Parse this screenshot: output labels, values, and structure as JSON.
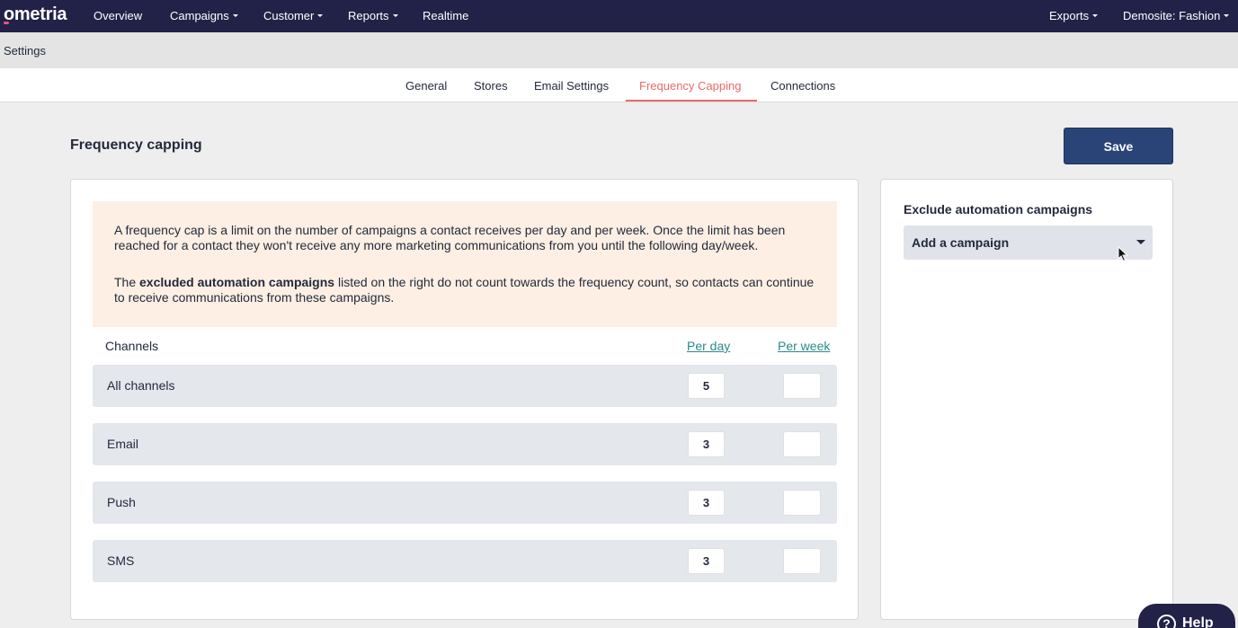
{
  "app": {
    "brand": "ometria",
    "accent_color": "#e86a6a",
    "nav_color": "#222248"
  },
  "topnav": {
    "items": [
      {
        "label": "Overview",
        "has_dropdown": false
      },
      {
        "label": "Campaigns",
        "has_dropdown": true
      },
      {
        "label": "Customer",
        "has_dropdown": true
      },
      {
        "label": "Reports",
        "has_dropdown": true
      },
      {
        "label": "Realtime",
        "has_dropdown": false
      }
    ],
    "right_items": [
      {
        "label": "Exports",
        "has_dropdown": true
      },
      {
        "label": "Demosite: Fashion",
        "has_dropdown": true
      }
    ]
  },
  "breadcrumb": {
    "label": "Settings"
  },
  "tabs": [
    {
      "label": "General",
      "active": false
    },
    {
      "label": "Stores",
      "active": false
    },
    {
      "label": "Email Settings",
      "active": false
    },
    {
      "label": "Frequency Capping",
      "active": true
    },
    {
      "label": "Connections",
      "active": false
    }
  ],
  "header": {
    "title": "Frequency capping",
    "save_label": "Save"
  },
  "info": {
    "paragraph1": "A frequency cap is a limit on the number of campaigns a contact receives per day and per week. Once the limit has been reached for a contact they won't receive any more marketing communications from you until the following day/week.",
    "paragraph2_prefix": "The ",
    "paragraph2_bold": "excluded automation campaigns",
    "paragraph2_suffix": " listed on the right do not count towards the frequency count, so contacts can continue to receive communications from these campaigns."
  },
  "table": {
    "channels_header": "Channels",
    "per_day_header": "Per day",
    "per_week_header": "Per week",
    "rows": [
      {
        "channel": "All channels",
        "per_day": "5",
        "per_week": ""
      },
      {
        "channel": "Email",
        "per_day": "3",
        "per_week": ""
      },
      {
        "channel": "Push",
        "per_day": "3",
        "per_week": ""
      },
      {
        "channel": "SMS",
        "per_day": "3",
        "per_week": ""
      }
    ]
  },
  "side": {
    "title": "Exclude automation campaigns",
    "dropdown_label": "Add a campaign"
  },
  "help": {
    "label": "Help",
    "icon": "question-icon"
  }
}
